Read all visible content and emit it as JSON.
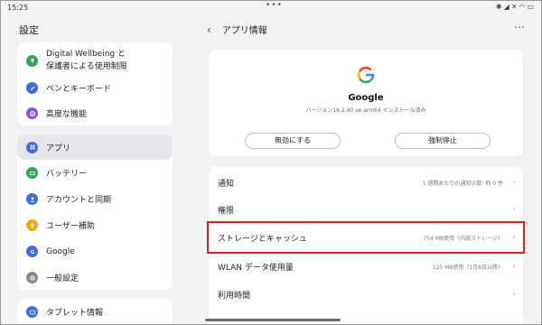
{
  "status": {
    "time": "15:25",
    "dots": "•••"
  },
  "sidebar": {
    "title": "設定",
    "items": [
      {
        "label_line1": "Digital Wellbeing と",
        "label_line2": "保護者による使用制限",
        "icon": "wellbeing-icon",
        "color": "#2fa84f"
      },
      {
        "label": "ペンとキーボード",
        "icon": "pen-icon",
        "color": "#3b6fe0"
      },
      {
        "label": "高度な機能",
        "icon": "advanced-features-icon",
        "color": "#8a4fe0"
      },
      {
        "label": "アプリ",
        "icon": "apps-icon",
        "color": "#3b6fe0"
      },
      {
        "label": "バッテリー",
        "icon": "battery-icon",
        "color": "#2fa84f"
      },
      {
        "label": "アカウントと同期",
        "icon": "account-icon",
        "color": "#3b6fe0"
      },
      {
        "label": "ユーザー補助",
        "icon": "accessibility-icon",
        "color": "#f0a81b"
      },
      {
        "label": "Google",
        "icon": "google-icon",
        "color": "#3b6fe0"
      },
      {
        "label": "一般設定",
        "icon": "general-settings-icon",
        "color": "#8a8a8a"
      },
      {
        "label": "タブレット情報",
        "icon": "tablet-info-icon",
        "color": "#3b6fe0"
      }
    ]
  },
  "header": {
    "title": "アプリ情報",
    "back": "‹",
    "more": "⋯"
  },
  "app": {
    "name": "Google",
    "version": "バージョン16.2.40.ve.arm64 インストール済み",
    "disable_label": "無効にする",
    "force_stop_label": "強制停止"
  },
  "rows": [
    {
      "label": "通知",
      "value": "1 週間あたりの通知の数: 約 0 件"
    },
    {
      "label": "権限",
      "value": ""
    },
    {
      "label": "ストレージとキャッシュ",
      "value": "754 MB使用（内部ストレージ）"
    },
    {
      "label": "WLAN データ使用量",
      "value": "125 MB使用（1月8日以降）"
    },
    {
      "label": "利用時間",
      "value": ""
    }
  ],
  "colors": {
    "highlight": "#e0211f",
    "card": "#ffffff",
    "background": "#f2f2f4"
  }
}
